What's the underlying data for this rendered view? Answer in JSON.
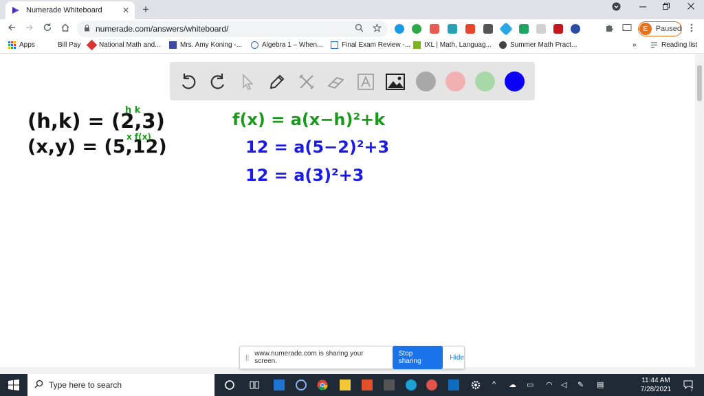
{
  "browser": {
    "tab_title": "Numerade Whiteboard",
    "tab_close": "✕",
    "new_tab": "+",
    "url": "numerade.com/answers/whiteboard/",
    "profile_initial": "E",
    "profile_status": "Paused"
  },
  "bookmarks": [
    {
      "label": "Apps"
    },
    {
      "label": "Bill Pay"
    },
    {
      "label": "National Math and..."
    },
    {
      "label": "Mrs. Amy Koning -..."
    },
    {
      "label": "Algebra 1 – When..."
    },
    {
      "label": "Final Exam Review -..."
    },
    {
      "label": "IXL | Math, Languag..."
    },
    {
      "label": "Summer Math Pract..."
    }
  ],
  "bookmarks_more": "»",
  "reading_list": "Reading list",
  "whiteboard": {
    "tools": [
      "undo-icon",
      "redo-icon",
      "pointer-icon",
      "pen-icon",
      "tools-icon",
      "eraser-icon",
      "text-icon",
      "image-icon"
    ],
    "colors": [
      "#a8a8a8",
      "#f2b1b1",
      "#a8d8a8",
      "#0a00f5"
    ],
    "ink": {
      "black": "#111111",
      "green": "#1a9a1a",
      "blue": "#1a1ae6"
    },
    "lines": {
      "hk": "(h,k) = (2,3)",
      "hk_labels": "h  k",
      "xy": "(x,y) = (5,12)",
      "xy_labels": "x  f(x)",
      "eq1": "f(x) = a(x−h)²+k",
      "eq2": "12 = a(5−2)²+3",
      "eq3": "12 = a(3)²+3"
    }
  },
  "share_bar": {
    "message": "www.numerade.com is sharing your screen.",
    "stop": "Stop sharing",
    "hide": "Hide"
  },
  "taskbar": {
    "search_placeholder": "Type here to search",
    "time": "11:44 AM",
    "date": "7/28/2021",
    "notification_count": "7"
  }
}
